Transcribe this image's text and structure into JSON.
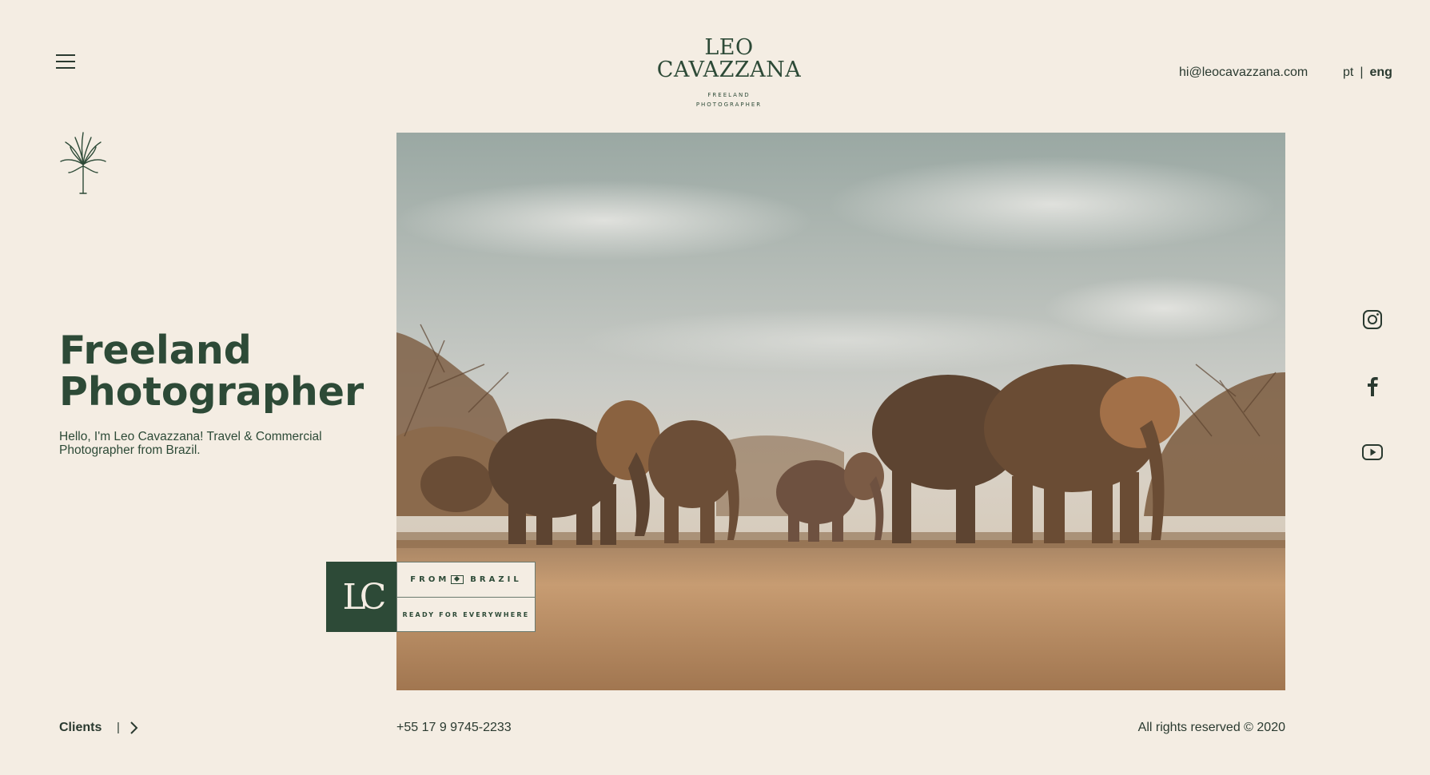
{
  "header": {
    "logo_line1": "LEO",
    "logo_line2": "CAVAZZANA",
    "logo_sub1": "FREELAND",
    "logo_sub2": "PHOTOGRAPHER",
    "email": "hi@leocavazzana.com",
    "lang_pt": "pt",
    "lang_sep": "|",
    "lang_eng": "eng"
  },
  "hero": {
    "headline": "Freeland Photographer",
    "tagline": "Hello, I'm Leo Cavazzana! Travel & Commercial Photographer from Brazil.",
    "photo_alt": "Herd of elephants crossing a dirt road at sunset"
  },
  "badge": {
    "monogram": "LC",
    "line1_from": "FROM",
    "line1_country": "BRAZIL",
    "line2": "READY FOR EVERYWHERE"
  },
  "social": {
    "icons": [
      "instagram-icon",
      "facebook-icon",
      "youtube-icon"
    ]
  },
  "footer": {
    "clients_label": "Clients",
    "clients_sep": "|",
    "phone": "+55 17 9 9745-2233",
    "rights": "All rights reserved © 2020"
  },
  "colors": {
    "background": "#f4ede3",
    "brand_green": "#2d4a37",
    "text_dark": "#2a3a30"
  }
}
